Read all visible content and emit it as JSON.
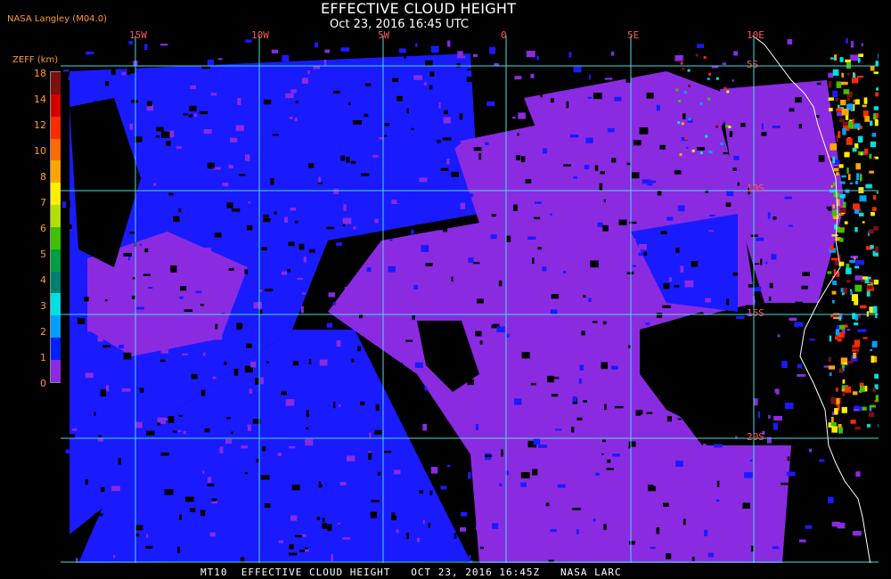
{
  "header": {
    "title": "EFFECTIVE CLOUD HEIGHT",
    "subtitle": "Oct 23, 2016 16:45 UTC",
    "credit": "NASA Langley (M04.0)"
  },
  "legend": {
    "title": "ZEFF (km)",
    "ticks": [
      "18",
      "14",
      "12",
      "10",
      "8",
      "7",
      "6",
      "5",
      "4",
      "3",
      "2",
      "1",
      "0"
    ],
    "colors": [
      "#7a1010",
      "#d40000",
      "#ff2a00",
      "#ff6a00",
      "#ffa500",
      "#ffee00",
      "#b0e000",
      "#40c000",
      "#00a040",
      "#008070",
      "#00e0e0",
      "#00a0ff",
      "#0020ff",
      "#8a2be2"
    ]
  },
  "grid": {
    "line_color": "#40e0e0",
    "lon_labels": [
      "15W",
      "10W",
      "5W",
      "0",
      "5E",
      "10E"
    ],
    "lat_labels": [
      "5S",
      "10S",
      "15S",
      "20S"
    ]
  },
  "map_colors": {
    "background": "#000000",
    "low_cloud": "#8a2be2",
    "mid_cloud": "#1a1aff",
    "coast": "#ffffff"
  },
  "footer": {
    "text": "MT10  EFFECTIVE CLOUD HEIGHT   OCT 23, 2016 16:45Z   NASA LARC"
  }
}
